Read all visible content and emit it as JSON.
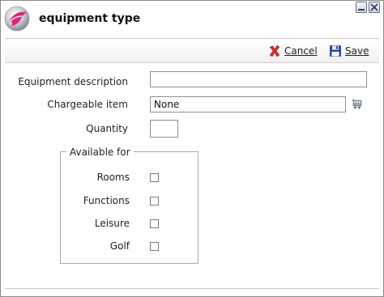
{
  "window": {
    "title": "equipment type",
    "buttons": [
      {
        "name": "minimize-icon"
      },
      {
        "name": "close-icon"
      }
    ]
  },
  "toolbar": {
    "cancel_label": "Cancel",
    "save_label": "Save",
    "cancel_icon": "red-x-icon",
    "save_icon": "floppy-disk-icon"
  },
  "form": {
    "description_label": "Equipment description",
    "description_value": "",
    "chargeable_label": "Chargeable item",
    "chargeable_value": "None",
    "chargeable_lookup_icon": "cart-lookup-icon",
    "quantity_label": "Quantity",
    "quantity_value": ""
  },
  "available_for": {
    "legend": "Available for",
    "options": [
      {
        "label": "Rooms",
        "checked": false
      },
      {
        "label": "Functions",
        "checked": false
      },
      {
        "label": "Leisure",
        "checked": false
      },
      {
        "label": "Golf",
        "checked": false
      }
    ]
  },
  "colors": {
    "accent_pink": "#d8267a",
    "cancel_red": "#d42a2a",
    "save_blue": "#2a4f9a"
  }
}
